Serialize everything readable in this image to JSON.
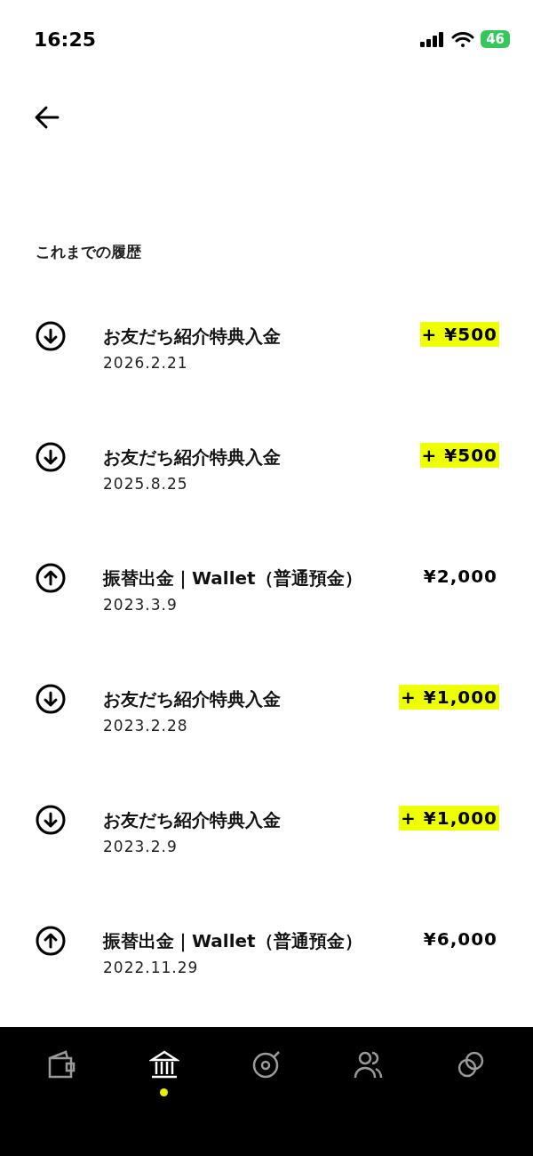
{
  "status_bar": {
    "time": "16:25",
    "battery": "46"
  },
  "section_title": "これまでの履歴",
  "transactions": [
    {
      "kind": "deposit",
      "title": "お友だち紹介特典入金",
      "date": "2026.2.21",
      "amount": "+ ¥500",
      "highlighted": true
    },
    {
      "kind": "deposit",
      "title": "お友だち紹介特典入金",
      "date": "2025.8.25",
      "amount": "+ ¥500",
      "highlighted": true
    },
    {
      "kind": "withdrawal",
      "title": "振替出金｜Wallet（普通預金）",
      "date": "2023.3.9",
      "amount": "¥2,000",
      "highlighted": false
    },
    {
      "kind": "deposit",
      "title": "お友だち紹介特典入金",
      "date": "2023.2.28",
      "amount": "+ ¥1,000",
      "highlighted": true
    },
    {
      "kind": "deposit",
      "title": "お友だち紹介特典入金",
      "date": "2023.2.9",
      "amount": "+ ¥1,000",
      "highlighted": true
    },
    {
      "kind": "withdrawal",
      "title": "振替出金｜Wallet（普通預金）",
      "date": "2022.11.29",
      "amount": "¥6,000",
      "highlighted": false
    }
  ],
  "bottom_nav": [
    {
      "kind": "wallet",
      "selected": false
    },
    {
      "kind": "bank",
      "selected": true
    },
    {
      "kind": "music",
      "selected": false
    },
    {
      "kind": "people",
      "selected": false
    },
    {
      "kind": "link",
      "selected": false
    }
  ]
}
